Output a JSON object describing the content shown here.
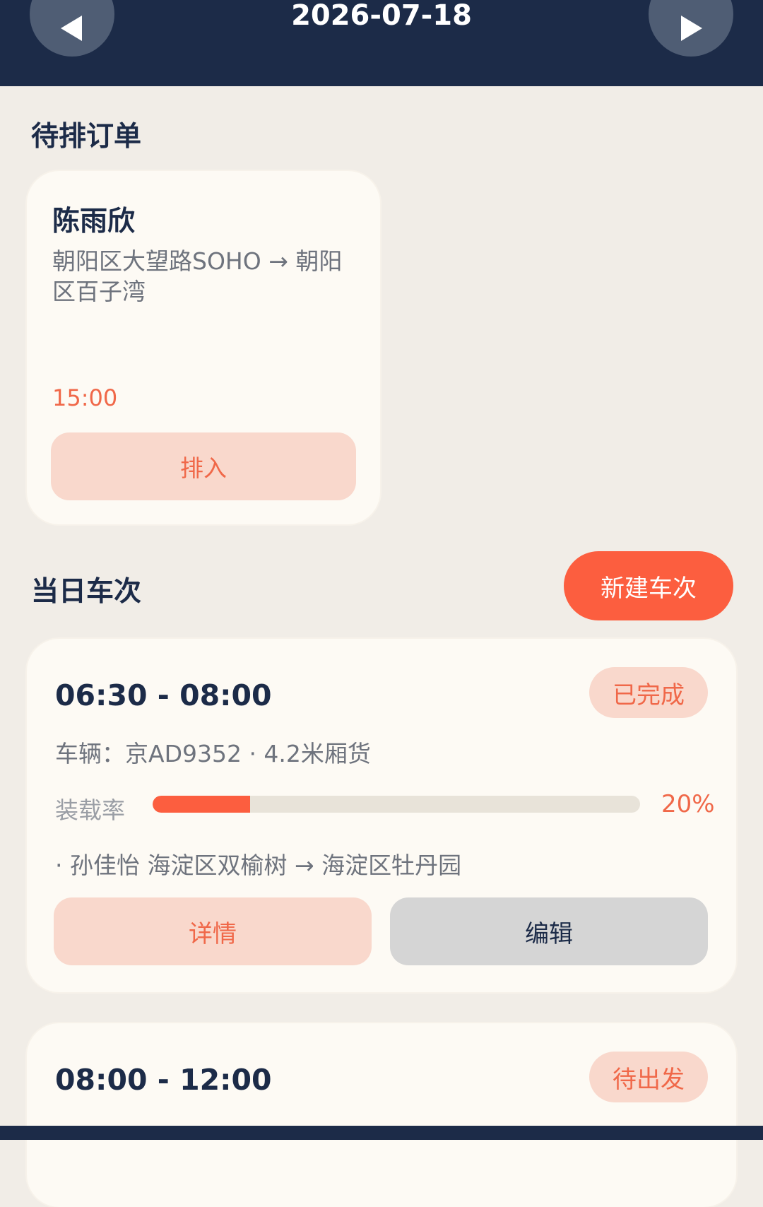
{
  "header": {
    "date": "2026-07-18",
    "prev_icon": "triangle-left-icon",
    "next_icon": "triangle-right-icon"
  },
  "pending": {
    "title": "待排订单",
    "orders": [
      {
        "name": "陈雨欣",
        "route": "朝阳区大望路SOHO → 朝阳区百子湾",
        "time": "15:00",
        "action": "排入"
      }
    ]
  },
  "trips": {
    "title": "当日车次",
    "new_button": "新建车次",
    "items": [
      {
        "time_range": "06:30 - 08:00",
        "status": "已完成",
        "vehicle": "车辆：京AD9352 · 4.2米厢货",
        "load_label": "装载率",
        "load_percent": 20,
        "load_text": "20%",
        "stop": "· 孙佳怡 海淀区双榆树 → 海淀区牡丹园",
        "detail_button": "详情",
        "edit_button": "编辑"
      },
      {
        "time_range": "08:00 - 12:00",
        "status": "待出发"
      }
    ]
  },
  "colors": {
    "navy": "#1c2b48",
    "accent": "#fc5e3f",
    "accent_soft": "#f9d8cc",
    "background": "#f1ede7"
  }
}
